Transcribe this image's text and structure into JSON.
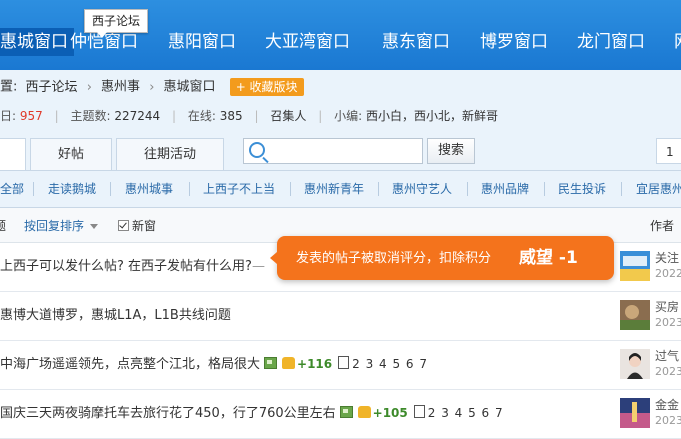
{
  "nav": {
    "tooltip": "西子论坛",
    "items": [
      "惠城窗口",
      "仲恺窗口",
      "惠阳窗口",
      "大亚湾窗口",
      "惠东窗口",
      "博罗窗口",
      "龙门窗口",
      "网"
    ]
  },
  "breadcrumb": {
    "prefix": "置:",
    "items": [
      "西子论坛",
      "惠州事",
      "惠城窗口"
    ],
    "fav_button": "+ 收藏版块"
  },
  "stats": {
    "today_prefix": "日:",
    "today_value": "957",
    "topics_label": "主题数:",
    "topics_value": "227244",
    "online_label": "在线:",
    "online_value": "385",
    "convener": "召集人",
    "editors_label": "小编:",
    "editors_value": "西小白，西小北，新鲜哥"
  },
  "tabs": {
    "good_posts": "好帖",
    "past_events": "往期活动",
    "search_placeholder": "",
    "search_button": "搜索",
    "page_number": "1"
  },
  "categories": [
    "全部",
    "走读鹅城",
    "惠州城事",
    "上西子不上当",
    "惠州新青年",
    "惠州守艺人",
    "惠州品牌",
    "民生投诉",
    "宜居惠州"
  ],
  "list_header": {
    "sort": "按回复排序",
    "new_window": "新窗",
    "author": "作者"
  },
  "threads": [
    {
      "title": "上西子可以发什么帖? 在西子发帖有什么用?",
      "more": "—",
      "author": "关注",
      "year": "2022"
    },
    {
      "title": "惠博大道博罗，惠城L1A，L1B共线问题",
      "author": "买房",
      "year": "2023"
    },
    {
      "title": "中海广场遥遥领先，点亮整个江北，格局很大",
      "heat": "+116",
      "pages": "2 3 4 5 6 7",
      "author": "过气",
      "year": "2023"
    },
    {
      "title": "国庆三天两夜骑摩托车去旅行花了450，行了760公里左右",
      "heat": "+105",
      "pages": "2 3 4 5 6 7",
      "author": "金金",
      "year": "2023"
    }
  ],
  "toast": {
    "message": "发表的帖子被取消评分，扣除积分",
    "penalty": "威望 -1"
  },
  "colors": {
    "nav_blue": "#1a78d2",
    "toast_orange": "#f4731c",
    "fav_orange": "#f39b1d",
    "stat_red": "#e0392a"
  }
}
